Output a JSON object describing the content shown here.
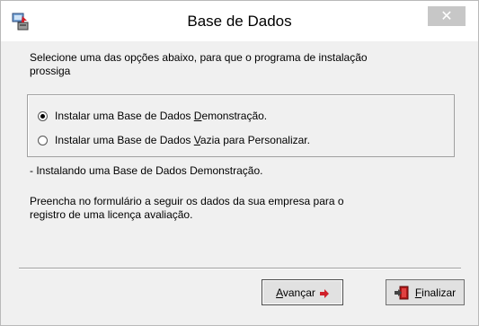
{
  "window": {
    "title": "Base de Dados",
    "close_symbol": "✕",
    "app_icon": "installer-icon"
  },
  "intro": {
    "line1": "Selecione uma das opções abaixo, para que o programa de instalação",
    "line2": "prossiga"
  },
  "options": [
    {
      "prefix": "Instalar uma Base de Dados ",
      "accel": "D",
      "suffix": "emonstração.",
      "checked": true
    },
    {
      "prefix": "Instalar uma Base de Dados ",
      "accel": "V",
      "suffix": "azia para Personalizar.",
      "checked": false
    }
  ],
  "status_text": "- Instalando uma Base de Dados Demonstração.",
  "info": {
    "line1": "Preencha no formulário a seguir os dados da sua empresa para o",
    "line2": "registro de uma licença avaliação."
  },
  "buttons": {
    "advance": {
      "accel": "A",
      "rest": "vançar",
      "icon": "arrow-right-icon"
    },
    "finish": {
      "accel": "F",
      "rest": "inalizar",
      "icon": "exit-door-icon"
    }
  },
  "colors": {
    "arrow": "#d0202a",
    "close_bg": "#c7c7c7"
  }
}
